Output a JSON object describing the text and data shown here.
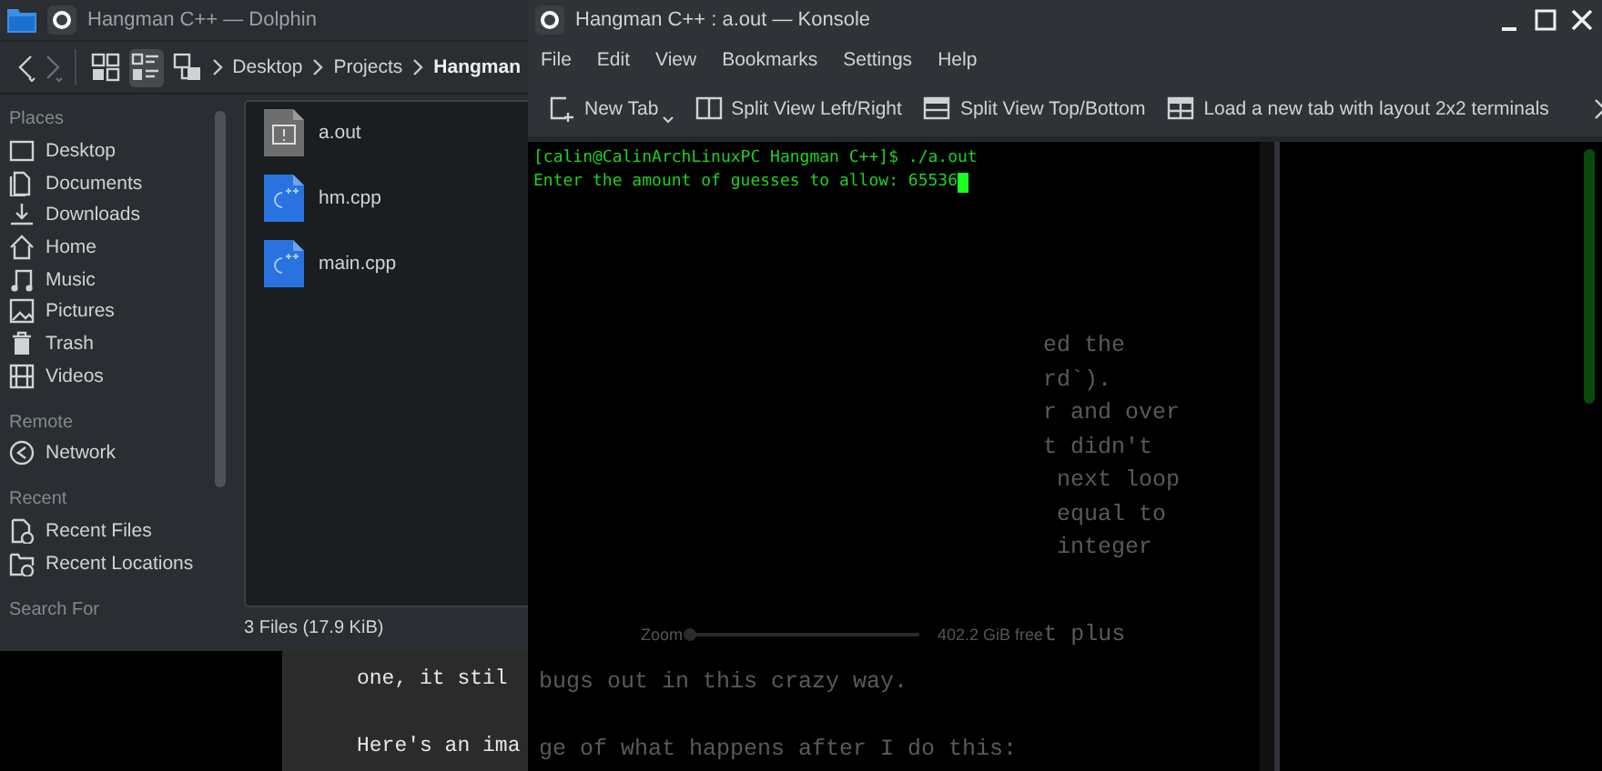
{
  "background_page": {
    "lines": [
      "one, it stil",
      "Here's an ima"
    ]
  },
  "dolphin": {
    "title": "Hangman C++ — Dolphin",
    "view_modes": [
      {
        "kind": "icons",
        "selected": false
      },
      {
        "kind": "details",
        "selected": true
      },
      {
        "kind": "split",
        "selected": false
      }
    ],
    "breadcrumb": [
      {
        "label": "Desktop",
        "current": false
      },
      {
        "label": "Projects",
        "current": false
      },
      {
        "label": "Hangman",
        "current": true
      }
    ],
    "sidebar": [
      {
        "heading": "Places",
        "items": [
          {
            "label": "Desktop",
            "kind": "desktop"
          },
          {
            "label": "Documents",
            "kind": "documents"
          },
          {
            "label": "Downloads",
            "kind": "downloads"
          },
          {
            "label": "Home",
            "kind": "home"
          },
          {
            "label": "Music",
            "kind": "music"
          },
          {
            "label": "Pictures",
            "kind": "pictures"
          },
          {
            "label": "Trash",
            "kind": "trash"
          },
          {
            "label": "Videos",
            "kind": "videos"
          }
        ]
      },
      {
        "heading": "Remote",
        "items": [
          {
            "label": "Network",
            "kind": "network"
          }
        ]
      },
      {
        "heading": "Recent",
        "items": [
          {
            "label": "Recent Files",
            "kind": "recent-files"
          },
          {
            "label": "Recent Locations",
            "kind": "recent-locations"
          }
        ]
      },
      {
        "heading": "Search For"
      }
    ],
    "files": [
      {
        "name": "a.out",
        "kind": "executable"
      },
      {
        "name": "hm.cpp",
        "kind": "cpp"
      },
      {
        "name": "main.cpp",
        "kind": "cpp"
      }
    ],
    "status": "3 Files (17.9 KiB)"
  },
  "konsole": {
    "title": "Hangman C++ : a.out — Konsole",
    "menu": [
      "File",
      "Edit",
      "View",
      "Bookmarks",
      "Settings",
      "Help"
    ],
    "toolbar": [
      {
        "label": "New Tab",
        "kind": "new-tab"
      },
      {
        "label": "Split View Left/Right",
        "kind": "split-left-right"
      },
      {
        "label": "Split View Top/Bottom",
        "kind": "split-top-bottom"
      },
      {
        "label": "Load a new tab with layout 2x2 terminals",
        "kind": "layout-grid"
      }
    ],
    "terminal": {
      "lines": [
        "[calin@CalinArchLinuxPC Hangman C++]$ ./a.out",
        "Enter the amount of guesses to allow: 65536"
      ],
      "cursor": true
    },
    "see_through_text": {
      "column": [
        "ed the",
        "rd`).",
        "r and over",
        "t didn't",
        " next loop",
        " equal to",
        " integer"
      ],
      "status_line": [
        "Zoom",
        "402.2 GiB free",
        "t plus"
      ],
      "page_lines": [
        "bugs out in this crazy way.",
        "ge of what happens after I do this:"
      ]
    }
  }
}
